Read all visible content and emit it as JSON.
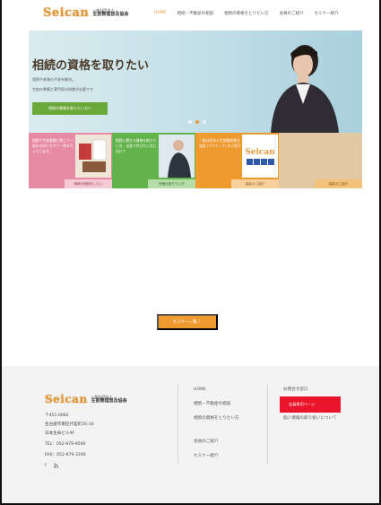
{
  "header": {
    "logo_mark": "Seican",
    "logo_small": "一般社団法人",
    "logo_big": "生前整理普及協会",
    "nav": [
      "HOME",
      "相続・不動産の相談",
      "相続の資格をとりたい方",
      "会員のご紹介",
      "セミナー紹介"
    ]
  },
  "hero": {
    "title": "相続の資格を取りたい",
    "sub1": "相続や老後の不安を解決。",
    "sub2": "生前の準備と専門家の知識が必要です",
    "button": "相続の資格を取りたい方へ"
  },
  "cards": [
    {
      "text": "相続や生前整理に関して一般の方向けセミナー等を行っています。",
      "link": "相続の相談をしたい"
    },
    {
      "text": "相続に関する資格を取りたい方、自身で学びたい方に向けて",
      "link": "資格を取りたい方"
    },
    {
      "text": "一般社団法人生前整理普及協会 (アクティブ) のご紹介",
      "link": "協会のご紹介"
    },
    {
      "text": "",
      "link": "協会のご紹介"
    }
  ],
  "card4_badge": "Seican",
  "seminar_button": "セミナー一覧 〉",
  "footer": {
    "logo_mark": "Seican",
    "logo_small": "一般社団法人",
    "logo_big": "生前整理普及協会",
    "postal": "〒451-0082",
    "address1": "名古屋市東区代官町35-16",
    "address2": "日本生命ビル9F",
    "tel": "TEL：052-979-9590",
    "fax": "FAX：052-979-3190",
    "social": [
      "f",
      "rss"
    ],
    "col1": [
      "HOME",
      "相続・不動産の相談",
      "相続の資格をとりたい方",
      "会員のご紹介",
      "セミナー紹介"
    ],
    "col2": [
      "お問合せ窓口",
      "会員専用ページ",
      "個人情報の取り扱いについて"
    ]
  },
  "colors": {
    "accent": "#e39a3a",
    "green": "#62b34b",
    "pink": "#e78aa3",
    "orange": "#ee9a2f",
    "highlight": "#e8152b"
  }
}
